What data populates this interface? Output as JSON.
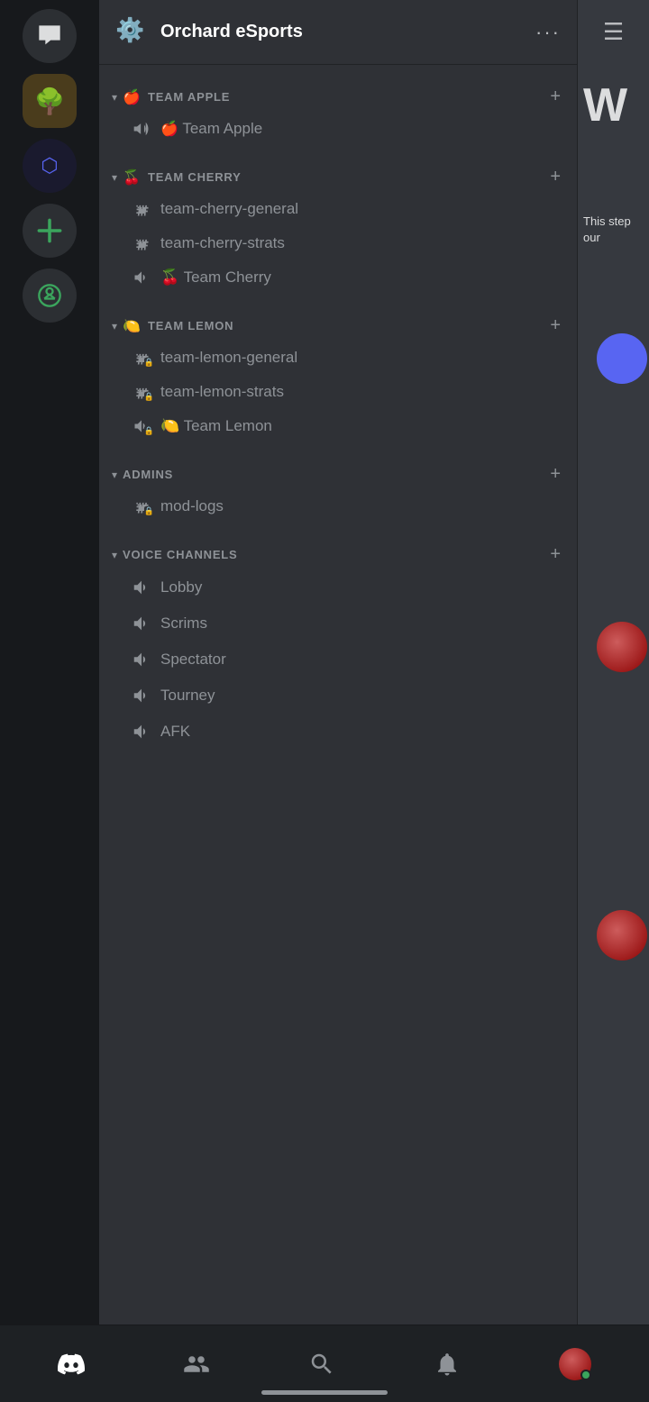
{
  "server": {
    "name": "Orchard eSports",
    "header_dots": "···"
  },
  "categories": [
    {
      "id": "team-apple",
      "name": "TEAM APPLE",
      "emoji": "🍎",
      "expanded": true,
      "channels": [
        {
          "type": "text",
          "name": "Team Apple",
          "locked": false,
          "emoji": "🍎",
          "is_voice": false,
          "is_category_channel": true
        }
      ]
    },
    {
      "id": "team-cherry",
      "name": "TEAM CHERRY",
      "emoji": "🍒",
      "expanded": true,
      "channels": [
        {
          "type": "text",
          "name": "team-cherry-general",
          "locked": false,
          "is_voice": false
        },
        {
          "type": "text",
          "name": "team-cherry-strats",
          "locked": false,
          "is_voice": false
        },
        {
          "type": "voice",
          "name": "Team Cherry",
          "locked": false,
          "emoji": "🍒",
          "is_voice": true
        }
      ]
    },
    {
      "id": "team-lemon",
      "name": "TEAM LEMON",
      "emoji": "🍋",
      "expanded": true,
      "channels": [
        {
          "type": "text",
          "name": "team-lemon-general",
          "locked": true,
          "is_voice": false
        },
        {
          "type": "text",
          "name": "team-lemon-strats",
          "locked": true,
          "is_voice": false
        },
        {
          "type": "voice",
          "name": "Team Lemon",
          "locked": false,
          "emoji": "🍋",
          "is_voice": true
        }
      ]
    },
    {
      "id": "admins",
      "name": "ADMINS",
      "emoji": "",
      "expanded": true,
      "channels": [
        {
          "type": "text",
          "name": "mod-logs",
          "locked": true,
          "is_voice": false
        }
      ]
    },
    {
      "id": "voice-channels",
      "name": "VOICE CHANNELS",
      "emoji": "",
      "expanded": true,
      "channels": [
        {
          "type": "voice",
          "name": "Lobby",
          "locked": false,
          "is_voice": true
        },
        {
          "type": "voice",
          "name": "Scrims",
          "locked": false,
          "is_voice": true
        },
        {
          "type": "voice",
          "name": "Spectator",
          "locked": false,
          "is_voice": true
        },
        {
          "type": "voice",
          "name": "Tourney",
          "locked": false,
          "is_voice": true
        },
        {
          "type": "voice",
          "name": "AFK",
          "locked": false,
          "is_voice": true
        }
      ]
    }
  ],
  "right_panel": {
    "text_partial": "This step our"
  },
  "bottom_nav": {
    "items": [
      {
        "id": "home",
        "label": "Home"
      },
      {
        "id": "friends",
        "label": "Friends"
      },
      {
        "id": "search",
        "label": "Search"
      },
      {
        "id": "notifications",
        "label": "Notifications"
      },
      {
        "id": "profile",
        "label": "Profile"
      }
    ]
  }
}
